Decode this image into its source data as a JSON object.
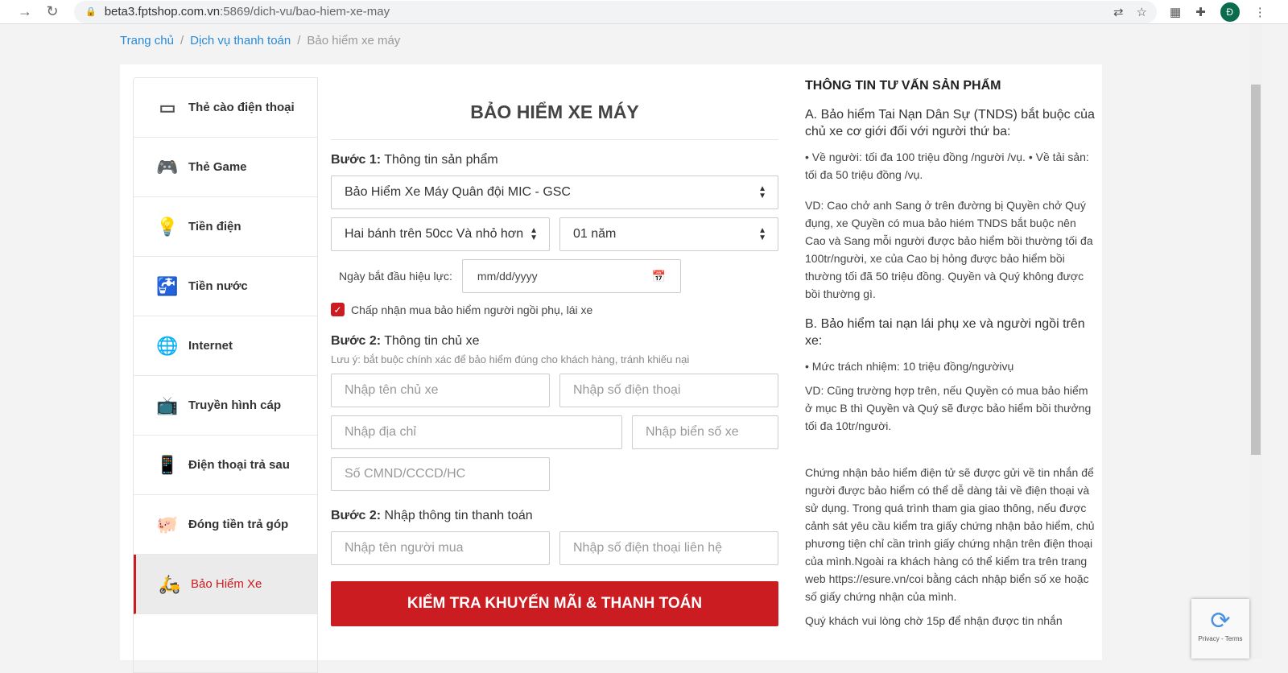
{
  "browser": {
    "url_host": "beta3.fptshop.com.vn",
    "url_path": ":5869/dich-vu/bao-hiem-xe-may",
    "avatar": "Đ"
  },
  "breadcrumb": [
    "Trang chủ",
    "Dịch vụ thanh toán",
    "Bảo hiểm xe máy"
  ],
  "sidebar": {
    "items": [
      {
        "label": "Thẻ cào điện thoại",
        "icon": "card-icon"
      },
      {
        "label": "Thẻ Game",
        "icon": "gamepad-icon"
      },
      {
        "label": "Tiền điện",
        "icon": "bulb-icon"
      },
      {
        "label": "Tiền nước",
        "icon": "faucet-icon"
      },
      {
        "label": "Internet",
        "icon": "globe-icon"
      },
      {
        "label": "Truyền hình cáp",
        "icon": "tv-icon"
      },
      {
        "label": "Điện thoại trả sau",
        "icon": "phone-icon"
      },
      {
        "label": "Đóng tiền trả góp",
        "icon": "piggy-icon"
      },
      {
        "label": "Bảo Hiểm Xe",
        "icon": "scooter-icon",
        "active": true
      }
    ]
  },
  "form": {
    "title": "BẢO HIỂM XE MÁY",
    "step1": {
      "prefix": "Bước 1:",
      "label": "Thông tin sản phẩm"
    },
    "product": "Bảo Hiểm Xe Máy Quân đội MIC - GSC",
    "vehicle_type": "Hai bánh trên 50cc Và nhỏ hơn",
    "duration": "01 năm",
    "start_date_label": "Ngày bắt đầu hiệu lực:",
    "start_date_placeholder": "mm/dd/yyyy",
    "accept_label": "Chấp nhận mua bảo hiểm người ngồi phụ, lái xe",
    "accept_checked": true,
    "step2": {
      "prefix": "Bước 2:",
      "label": "Thông tin chủ xe"
    },
    "note": "Lưu ý: bắt buộc chính xác để bảo hiểm đúng cho khách hàng, tránh khiếu nại",
    "owner_name_ph": "Nhập tên chủ xe",
    "owner_phone_ph": "Nhập số điện thoại",
    "address_ph": "Nhập địa chỉ",
    "plate_ph": "Nhập biển số xe",
    "id_ph": "Số CMND/CCCD/HC",
    "step3": {
      "prefix": "Bước 2:",
      "label": "Nhập thông tin thanh toán"
    },
    "buyer_name_ph": "Nhập tên người mua",
    "buyer_phone_ph": "Nhập số điện thoại liên hệ",
    "submit": "KIỂM TRA KHUYẾN MÃI & THANH TOÁN"
  },
  "info": {
    "title": "THÔNG TIN TƯ VẤN SẢN PHẨM",
    "a_heading": "A. Bảo hiểm Tai Nạn Dân Sự (TNDS) bắt buộc của chủ xe cơ giới đối với người thứ ba:",
    "a_bullets": "•  Về người: tối đa 100 triệu đồng /người /vụ. •  Về tải sản: tối đa 50 triệu đồng /vụ.",
    "a_example": "VD: Cao chở anh Sang ở trên đường bị Quyền chở Quý đụng, xe Quyền có mua bảo hiém TNDS bắt buộc nên Cao và Sang mỗi người được bảo hiểm bồi thường tối đa 100tr/người, xe của Cao bị hỏng được bảo hiểm bồi thường tối đã 50 triệu đồng. Quyền và Quý không được bồi thường gì.",
    "b_heading": "B. Bảo hiểm tai nạn lái phụ xe và người ngồi trên xe:",
    "b_bullet": "•  Mức trách nhiệm: 10 triệu đồng/ngườivụ",
    "b_example": "VD: Cũng trường hợp trên, nếu Quyền có mua bảo hiểm ở mục B thì Quyền và Quý sẽ được bảo hiểm bồi thưởng tối đa 10tr/người.",
    "certificate": "Chứng nhận bảo hiểm điện tử sẽ được gửi về tin nhắn để người được bảo hiểm có thể dễ dàng tải về điện thoại và sử dụng. Trong quá trình tham gia giao thông, nếu được cảnh sát yêu cầu kiểm tra giấy chứng nhận bảo hiểm, chủ phương tiện chỉ cần trình giấy chứng nhận trên điện thoại của mình.Ngoài ra khách hàng có thể kiểm tra trên trang web https://esure.vn/coi bằng cách nhập biển số xe hoặc số giấy chứng nhận của mình.",
    "wait": "Quý khách vui lòng chờ 15p để nhận được tin nhắn"
  },
  "recaptcha": "Privacy - Terms",
  "accent": "#cb1c22"
}
